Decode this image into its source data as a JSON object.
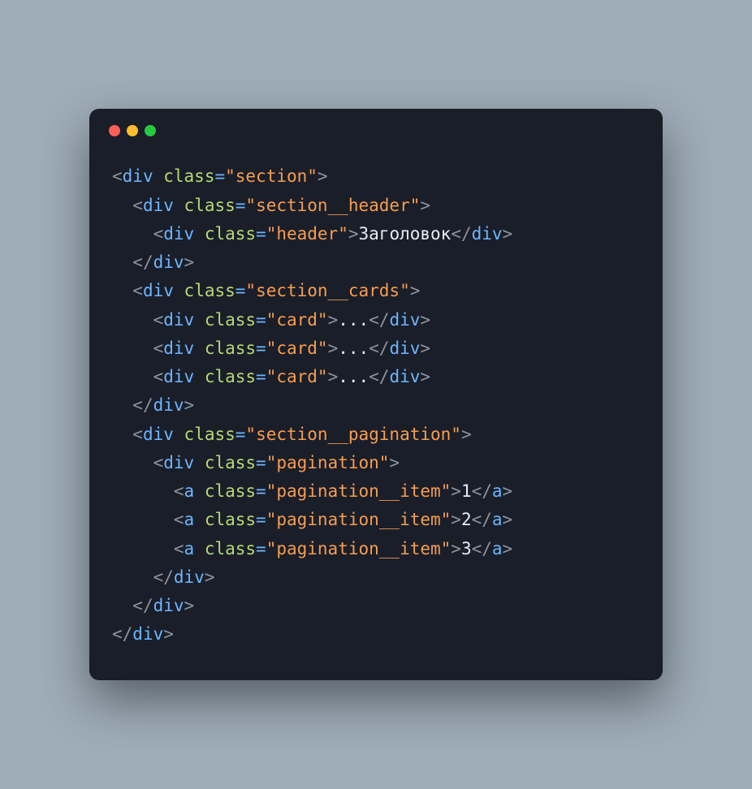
{
  "code": {
    "lines": [
      {
        "indent": 0,
        "type": "open",
        "tag": "div",
        "attr": "class",
        "value": "section"
      },
      {
        "indent": 1,
        "type": "open",
        "tag": "div",
        "attr": "class",
        "value": "section__header"
      },
      {
        "indent": 2,
        "type": "full",
        "tag": "div",
        "attr": "class",
        "value": "header",
        "text": "Заголовок"
      },
      {
        "indent": 1,
        "type": "close",
        "tag": "div"
      },
      {
        "indent": 1,
        "type": "open",
        "tag": "div",
        "attr": "class",
        "value": "section__cards"
      },
      {
        "indent": 2,
        "type": "full",
        "tag": "div",
        "attr": "class",
        "value": "card",
        "text": "..."
      },
      {
        "indent": 2,
        "type": "full",
        "tag": "div",
        "attr": "class",
        "value": "card",
        "text": "..."
      },
      {
        "indent": 2,
        "type": "full",
        "tag": "div",
        "attr": "class",
        "value": "card",
        "text": "..."
      },
      {
        "indent": 1,
        "type": "close",
        "tag": "div"
      },
      {
        "indent": 1,
        "type": "open",
        "tag": "div",
        "attr": "class",
        "value": "section__pagination"
      },
      {
        "indent": 2,
        "type": "open",
        "tag": "div",
        "attr": "class",
        "value": "pagination"
      },
      {
        "indent": 3,
        "type": "full",
        "tag": "a",
        "attr": "class",
        "value": "pagination__item",
        "text": "1"
      },
      {
        "indent": 3,
        "type": "full",
        "tag": "a",
        "attr": "class",
        "value": "pagination__item",
        "text": "2"
      },
      {
        "indent": 3,
        "type": "full",
        "tag": "a",
        "attr": "class",
        "value": "pagination__item",
        "text": "3"
      },
      {
        "indent": 2,
        "type": "close",
        "tag": "div"
      },
      {
        "indent": 1,
        "type": "close",
        "tag": "div"
      },
      {
        "indent": 0,
        "type": "close",
        "tag": "div"
      }
    ]
  }
}
